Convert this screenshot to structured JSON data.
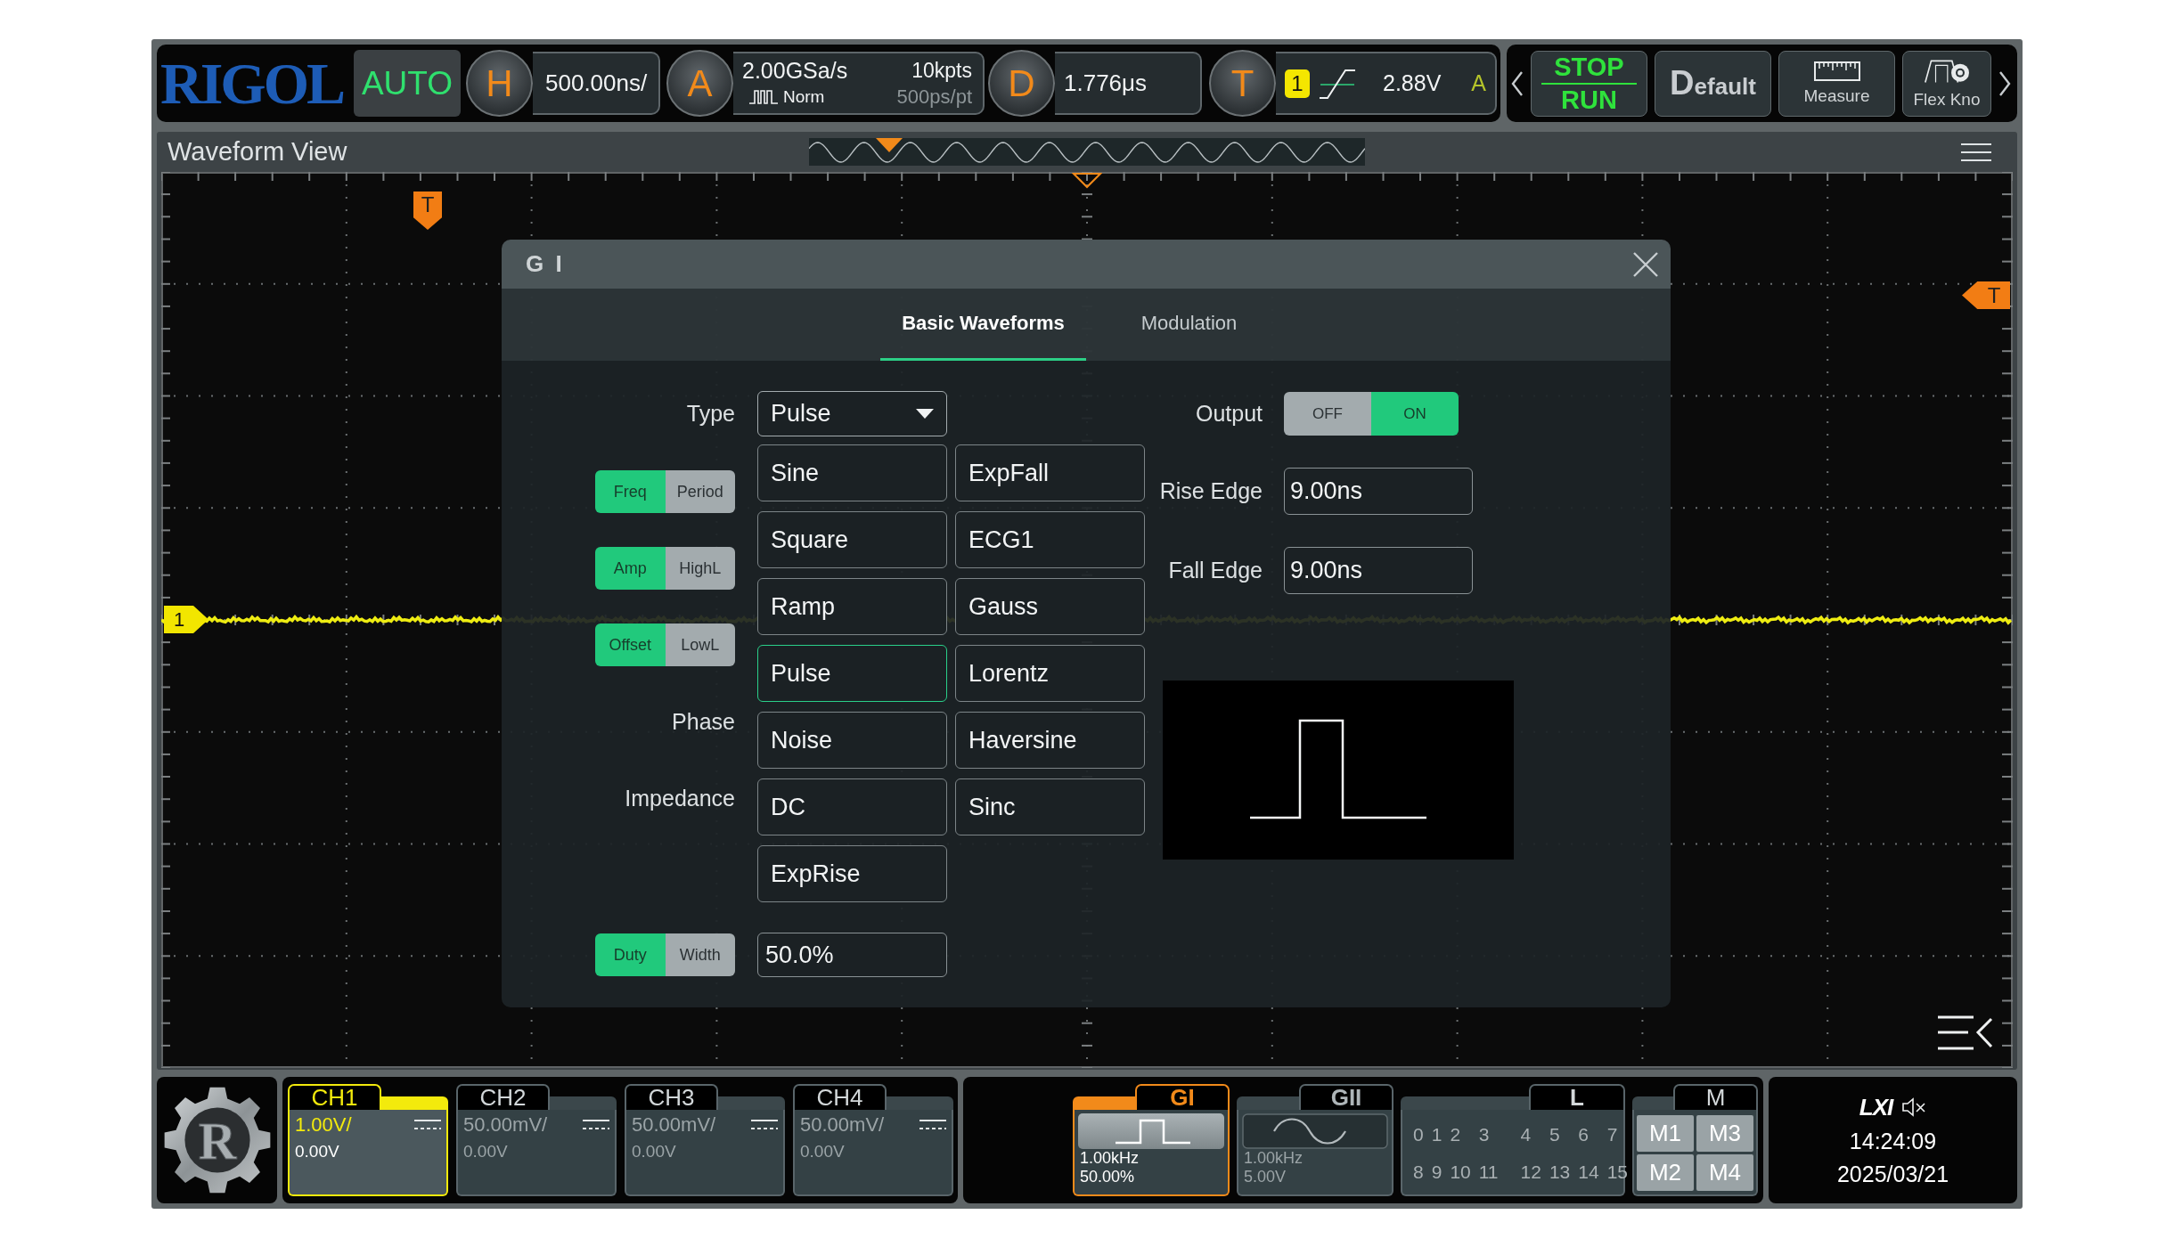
{
  "top_bar": {
    "logo": "RIGOL",
    "mode": "AUTO",
    "horizontal": {
      "key": "H",
      "scale": "500.00ns/"
    },
    "acquisition": {
      "key": "A",
      "sample_rate": "2.00GSa/s",
      "memory_depth": "10kpts",
      "mode": "Norm",
      "resolution": "500ps/pt"
    },
    "delay": {
      "key": "D",
      "value": "1.776μs"
    },
    "trigger": {
      "key": "T",
      "source": "1",
      "level": "2.88V",
      "sweep": "A"
    },
    "buttons": [
      {
        "kind": "run_stop",
        "labels": [
          "STOP",
          "RUN"
        ]
      },
      {
        "kind": "default",
        "label": "Default"
      },
      {
        "kind": "measure",
        "label": "Measure"
      },
      {
        "kind": "flex_knob",
        "label": "Flex Kno"
      }
    ]
  },
  "waveform_view": {
    "title": "Waveform View",
    "trigger_position_marker": "T",
    "trigger_level_marker": "T",
    "channel_marker": "1"
  },
  "generator_dialog": {
    "title": "G I",
    "tabs": [
      {
        "label": "Basic Waveforms",
        "selected": true
      },
      {
        "label": "Modulation",
        "selected": false
      }
    ],
    "type": {
      "label": "Type",
      "value": "Pulse",
      "expanded": true,
      "options": [
        {
          "label": "Sine",
          "selected": false
        },
        {
          "label": "Square",
          "selected": false
        },
        {
          "label": "Ramp",
          "selected": false
        },
        {
          "label": "Pulse",
          "selected": true
        },
        {
          "label": "Noise",
          "selected": false
        },
        {
          "label": "DC",
          "selected": false
        },
        {
          "label": "ExpRise",
          "selected": false
        },
        {
          "label": "ExpFall",
          "selected": false
        },
        {
          "label": "ECG1",
          "selected": false
        },
        {
          "label": "Gauss",
          "selected": false
        },
        {
          "label": "Lorentz",
          "selected": false
        },
        {
          "label": "Haversine",
          "selected": false
        },
        {
          "label": "Sinc",
          "selected": false
        }
      ]
    },
    "settings": [
      {
        "kind": "toggle",
        "options": [
          {
            "label": "Freq",
            "selected": true
          },
          {
            "label": "Period",
            "selected": false
          }
        ]
      },
      {
        "kind": "toggle",
        "options": [
          {
            "label": "Amp",
            "selected": true
          },
          {
            "label": "HighL",
            "selected": false
          }
        ]
      },
      {
        "kind": "toggle",
        "options": [
          {
            "label": "Offset",
            "selected": true
          },
          {
            "label": "LowL",
            "selected": false
          }
        ]
      },
      {
        "kind": "label",
        "label": "Phase"
      },
      {
        "kind": "label",
        "label": "Impedance"
      },
      {
        "kind": "toggle",
        "options": [
          {
            "label": "Duty",
            "selected": true
          },
          {
            "label": "Width",
            "selected": false
          }
        ],
        "value": "50.0%"
      }
    ],
    "output": {
      "label": "Output",
      "options": [
        {
          "label": "OFF",
          "selected": false
        },
        {
          "label": "ON",
          "selected": true
        }
      ]
    },
    "edges": [
      {
        "label": "Rise Edge",
        "value": "9.00ns"
      },
      {
        "label": "Fall Edge",
        "value": "9.00ns"
      }
    ]
  },
  "bottom_bar": {
    "menu_logo": "R",
    "channels": [
      {
        "name": "CH1",
        "on": true,
        "scale": "1.00V/",
        "offset": "0.00V"
      },
      {
        "name": "CH2",
        "on": false,
        "scale": "50.00mV/",
        "offset": "0.00V"
      },
      {
        "name": "CH3",
        "on": false,
        "scale": "50.00mV/",
        "offset": "0.00V"
      },
      {
        "name": "CH4",
        "on": false,
        "scale": "50.00mV/",
        "offset": "0.00V"
      }
    ],
    "generators": [
      {
        "kind": "pulse",
        "name": "GI",
        "on": true,
        "frequency": "1.00kHz",
        "value": "50.00%"
      },
      {
        "kind": "sine",
        "name": "GII",
        "on": false,
        "frequency": "1.00kHz",
        "value": "5.00V"
      }
    ],
    "logic": {
      "name": "L",
      "channels": [
        "0",
        "1",
        "2",
        "3",
        "4",
        "5",
        "6",
        "7",
        "8",
        "9",
        "10",
        "11",
        "12",
        "13",
        "14",
        "15"
      ]
    },
    "math": {
      "name": "M",
      "items": [
        "M1",
        "M3",
        "M2",
        "M4"
      ]
    },
    "status": {
      "lxi": "LXI",
      "muted": true,
      "time": "14:24:09",
      "date": "2025/03/21"
    }
  }
}
